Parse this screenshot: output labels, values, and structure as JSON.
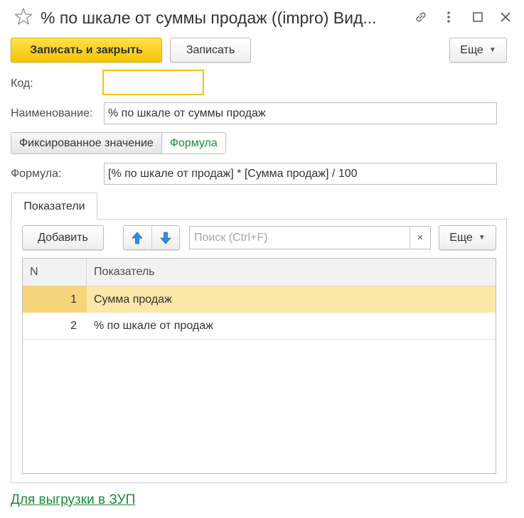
{
  "window": {
    "title": "% по шкале от суммы продаж ((impro) Вид...",
    "icons": [
      "star-icon",
      "link-icon",
      "more-vertical-icon",
      "maximize-icon",
      "close-icon"
    ]
  },
  "toolbar": {
    "save_close_label": "Записать и закрыть",
    "save_label": "Записать",
    "more_label": "Еще"
  },
  "form": {
    "code_label": "Код:",
    "code_value": "",
    "name_label": "Наименование:",
    "name_value": "% по шкале от суммы продаж",
    "mode_options": [
      "Фиксированное значение",
      "Формула"
    ],
    "mode_selected": "Формула",
    "formula_label": "Формула:",
    "formula_value": "[% по шкале от продаж] * [Сумма продаж] / 100"
  },
  "tabs": {
    "indicators_label": "Показатели"
  },
  "indicators": {
    "add_label": "Добавить",
    "search_placeholder": "Поиск (Ctrl+F)",
    "search_clear": "×",
    "more_label": "Еще",
    "columns": {
      "n": "N",
      "name": "Показатель"
    },
    "rows": [
      {
        "n": "1",
        "name": "Сумма продаж",
        "selected": true
      },
      {
        "n": "2",
        "name": "% по шкале от продаж",
        "selected": false
      }
    ]
  },
  "footer": {
    "link_label": "Для выгрузки в ЗУП"
  },
  "colors": {
    "primary_button": "#f5c400",
    "accent_green": "#1a8a3c",
    "selected_row": "#fbe7a8",
    "focus_border": "#f5c400"
  }
}
